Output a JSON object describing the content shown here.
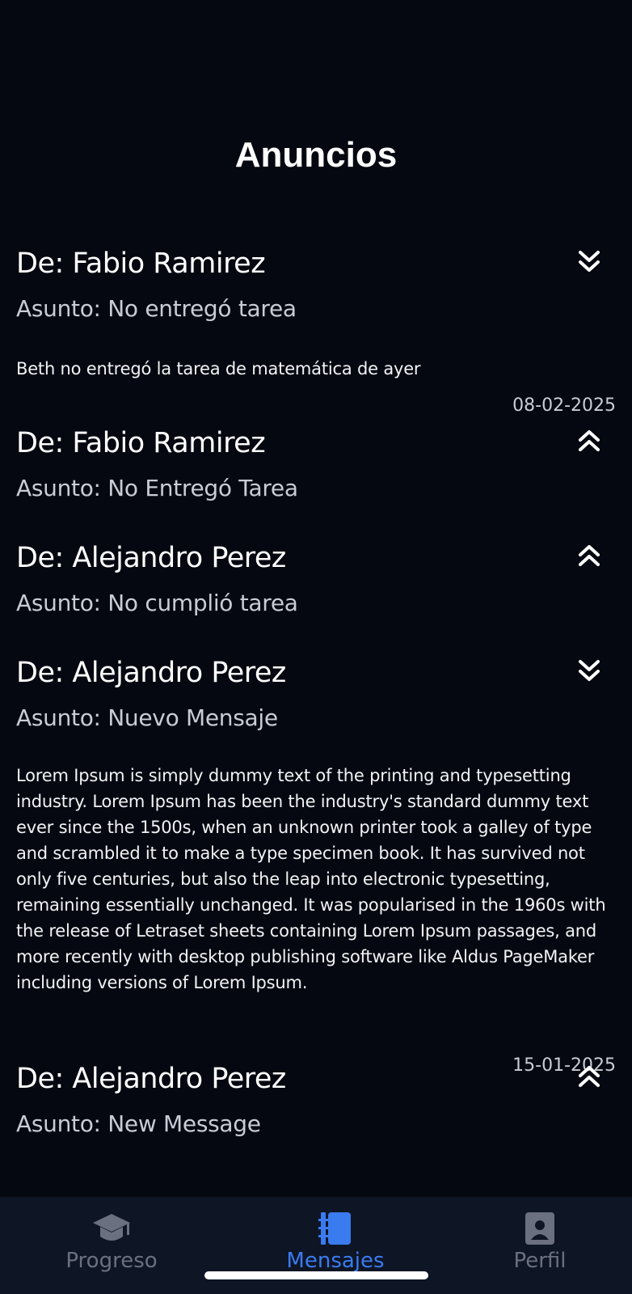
{
  "header": {
    "title": "Anuncios"
  },
  "messages": [
    {
      "from": "De: Fabio Ramirez",
      "subject": "Asunto: No entregó tarea",
      "body": "Beth no entregó la tarea de matemática de ayer",
      "date": "08-02-2025",
      "expanded": true,
      "toggle_icon": "chevron-double-down-icon"
    },
    {
      "from": "De: Fabio Ramirez",
      "subject": "Asunto: No Entregó Tarea",
      "expanded": false,
      "toggle_icon": "chevron-double-up-icon"
    },
    {
      "from": "De: Alejandro Perez",
      "subject": "Asunto: No cumplió tarea",
      "expanded": false,
      "toggle_icon": "chevron-double-up-icon"
    },
    {
      "from": "De: Alejandro Perez",
      "subject": "Asunto: Nuevo Mensaje",
      "body": "Lorem Ipsum is simply dummy text of the printing and typesetting industry. Lorem Ipsum has been the industry's standard dummy text ever since the 1500s, when an unknown printer took a galley of type and scrambled it to make a type specimen book. It has survived not only five centuries, but also the leap into electronic typesetting, remaining essentially unchanged. It was popularised in the 1960s with the release of Letraset sheets containing Lorem Ipsum passages, and more recently with desktop publishing software like Aldus PageMaker including versions of Lorem Ipsum.",
      "date": "15-01-2025",
      "expanded": true,
      "toggle_icon": "chevron-double-down-icon"
    },
    {
      "from": "De: Alejandro Perez",
      "subject": "Asunto: New Message",
      "expanded": false,
      "toggle_icon": "chevron-double-up-icon"
    }
  ],
  "tabbar": {
    "tabs": [
      {
        "label": "Progreso",
        "icon": "graduation-cap-icon",
        "active": false
      },
      {
        "label": "Mensajes",
        "icon": "book-icon",
        "active": true
      },
      {
        "label": "Perfil",
        "icon": "profile-card-icon",
        "active": false
      }
    ]
  },
  "colors": {
    "background": "#050810",
    "tabbar_background": "#0e1524",
    "active_tab": "#3b7bf0",
    "inactive_tab": "#6b7080",
    "subject_text": "#c9ccd6"
  }
}
